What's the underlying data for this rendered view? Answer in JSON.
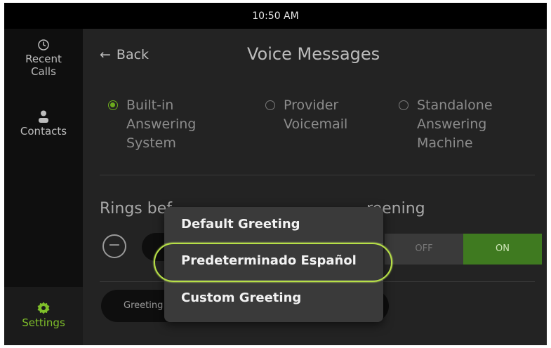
{
  "status_bar": {
    "time": "10:50 AM"
  },
  "sidebar": {
    "items": [
      {
        "label_line1": "Recent",
        "label_line2": "Calls",
        "icon": "clock-icon"
      },
      {
        "label": "Contacts",
        "icon": "person-icon"
      },
      {
        "label": "Settings",
        "icon": "gear-icon",
        "active": true
      }
    ]
  },
  "header": {
    "back_label": "Back",
    "title": "Voice Messages"
  },
  "answering_options": [
    {
      "lines": [
        "Built-in",
        "Answering",
        "System"
      ],
      "selected": true
    },
    {
      "lines": [
        "Provider",
        "Voicemail"
      ],
      "selected": false
    },
    {
      "lines": [
        "Standalone",
        "Answering",
        "Machine"
      ],
      "selected": false
    }
  ],
  "rings": {
    "label": "Rings bef"
  },
  "call_screening": {
    "label": "reening",
    "off_label": "OFF",
    "on_label": "ON",
    "value": "ON"
  },
  "greeting": {
    "field_label": "Greeting"
  },
  "greeting_menu": {
    "items": [
      "Default Greeting",
      "Predeterminado Español",
      "Custom Greeting"
    ],
    "highlighted": "Predeterminado Español"
  },
  "colors": {
    "accent": "#6cab1d",
    "on_toggle": "#3f7a20",
    "highlight_ring": "#b7e046",
    "background": "#232323"
  }
}
